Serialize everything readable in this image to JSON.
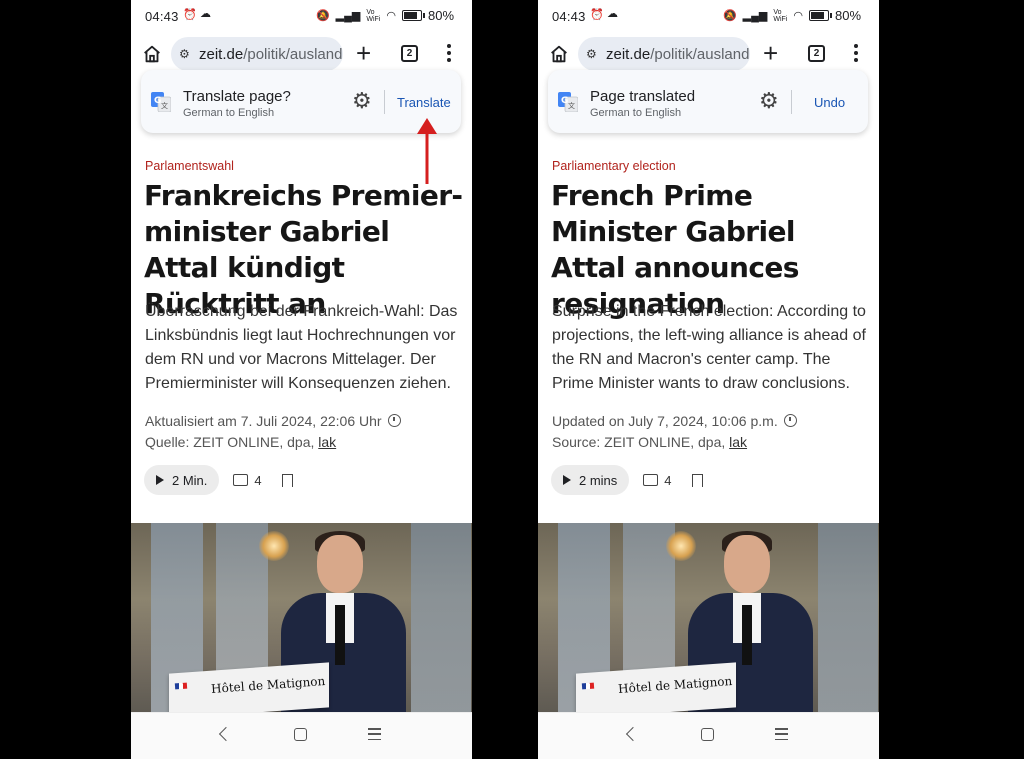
{
  "colors": {
    "accent_link": "#1a56b4",
    "kicker": "#b1231d",
    "arrow": "#d51f1f"
  },
  "left": {
    "status": {
      "time": "04:43",
      "battery": "80"
    },
    "url": {
      "domain": "zeit.de",
      "path": "/politik/ausland"
    },
    "tab_count": "2",
    "translate_bar": {
      "title": "Translate page?",
      "subtitle": "German to English",
      "action": "Translate"
    },
    "article": {
      "kicker": "Parlamentswahl",
      "headline": "Frankreichs Premier-minister Gabriel Attal kündigt Rücktritt an",
      "summary": "Überraschung bei der Frankreich-Wahl: Das Linksbündnis liegt laut Hochrechnungen vor dem RN und vor Macrons Mittelager. Der Premierminister will Konsequenzen ziehen.",
      "updated": "Aktualisiert am 7. Juli 2024, 22:06 Uhr",
      "source_prefix": "Quelle: ZEIT ONLINE, dpa, ",
      "source_link": "lak",
      "audio": "2 Min.",
      "comments": "4"
    },
    "photo_sign": "Hôtel de Matignon"
  },
  "right": {
    "status": {
      "time": "04:43",
      "battery": "80"
    },
    "url": {
      "domain": "zeit.de",
      "path": "/politik/ausland"
    },
    "tab_count": "2",
    "translate_bar": {
      "title": "Page translated",
      "subtitle": "German to English",
      "action": "Undo"
    },
    "article": {
      "kicker": "Parliamentary election",
      "headline": "French Prime Minister Gabriel Attal announces resignation",
      "summary": "Surprise in the French election: According to projections, the left-wing alliance is ahead of the RN and Macron's center camp. The Prime Minister wants to draw conclusions.",
      "updated": "Updated on July 7, 2024, 10:06 p.m.",
      "source_prefix": "Source: ZEIT ONLINE, dpa, ",
      "source_link": "lak",
      "audio": "2 mins",
      "comments": "4"
    },
    "photo_sign": "Hôtel de Matignon"
  },
  "icons": [
    "alarm-icon",
    "cloud-icon",
    "mute-icon",
    "signal-icon",
    "vowifi-icon",
    "wifi-icon",
    "battery-icon",
    "home-icon",
    "site-settings-icon",
    "new-tab-icon",
    "tab-switcher-icon",
    "overflow-menu-icon",
    "google-translate-icon",
    "gear-icon",
    "clock-icon",
    "play-icon",
    "comment-icon",
    "bookmark-icon",
    "nav-back-icon",
    "nav-home-icon",
    "nav-recents-icon"
  ]
}
